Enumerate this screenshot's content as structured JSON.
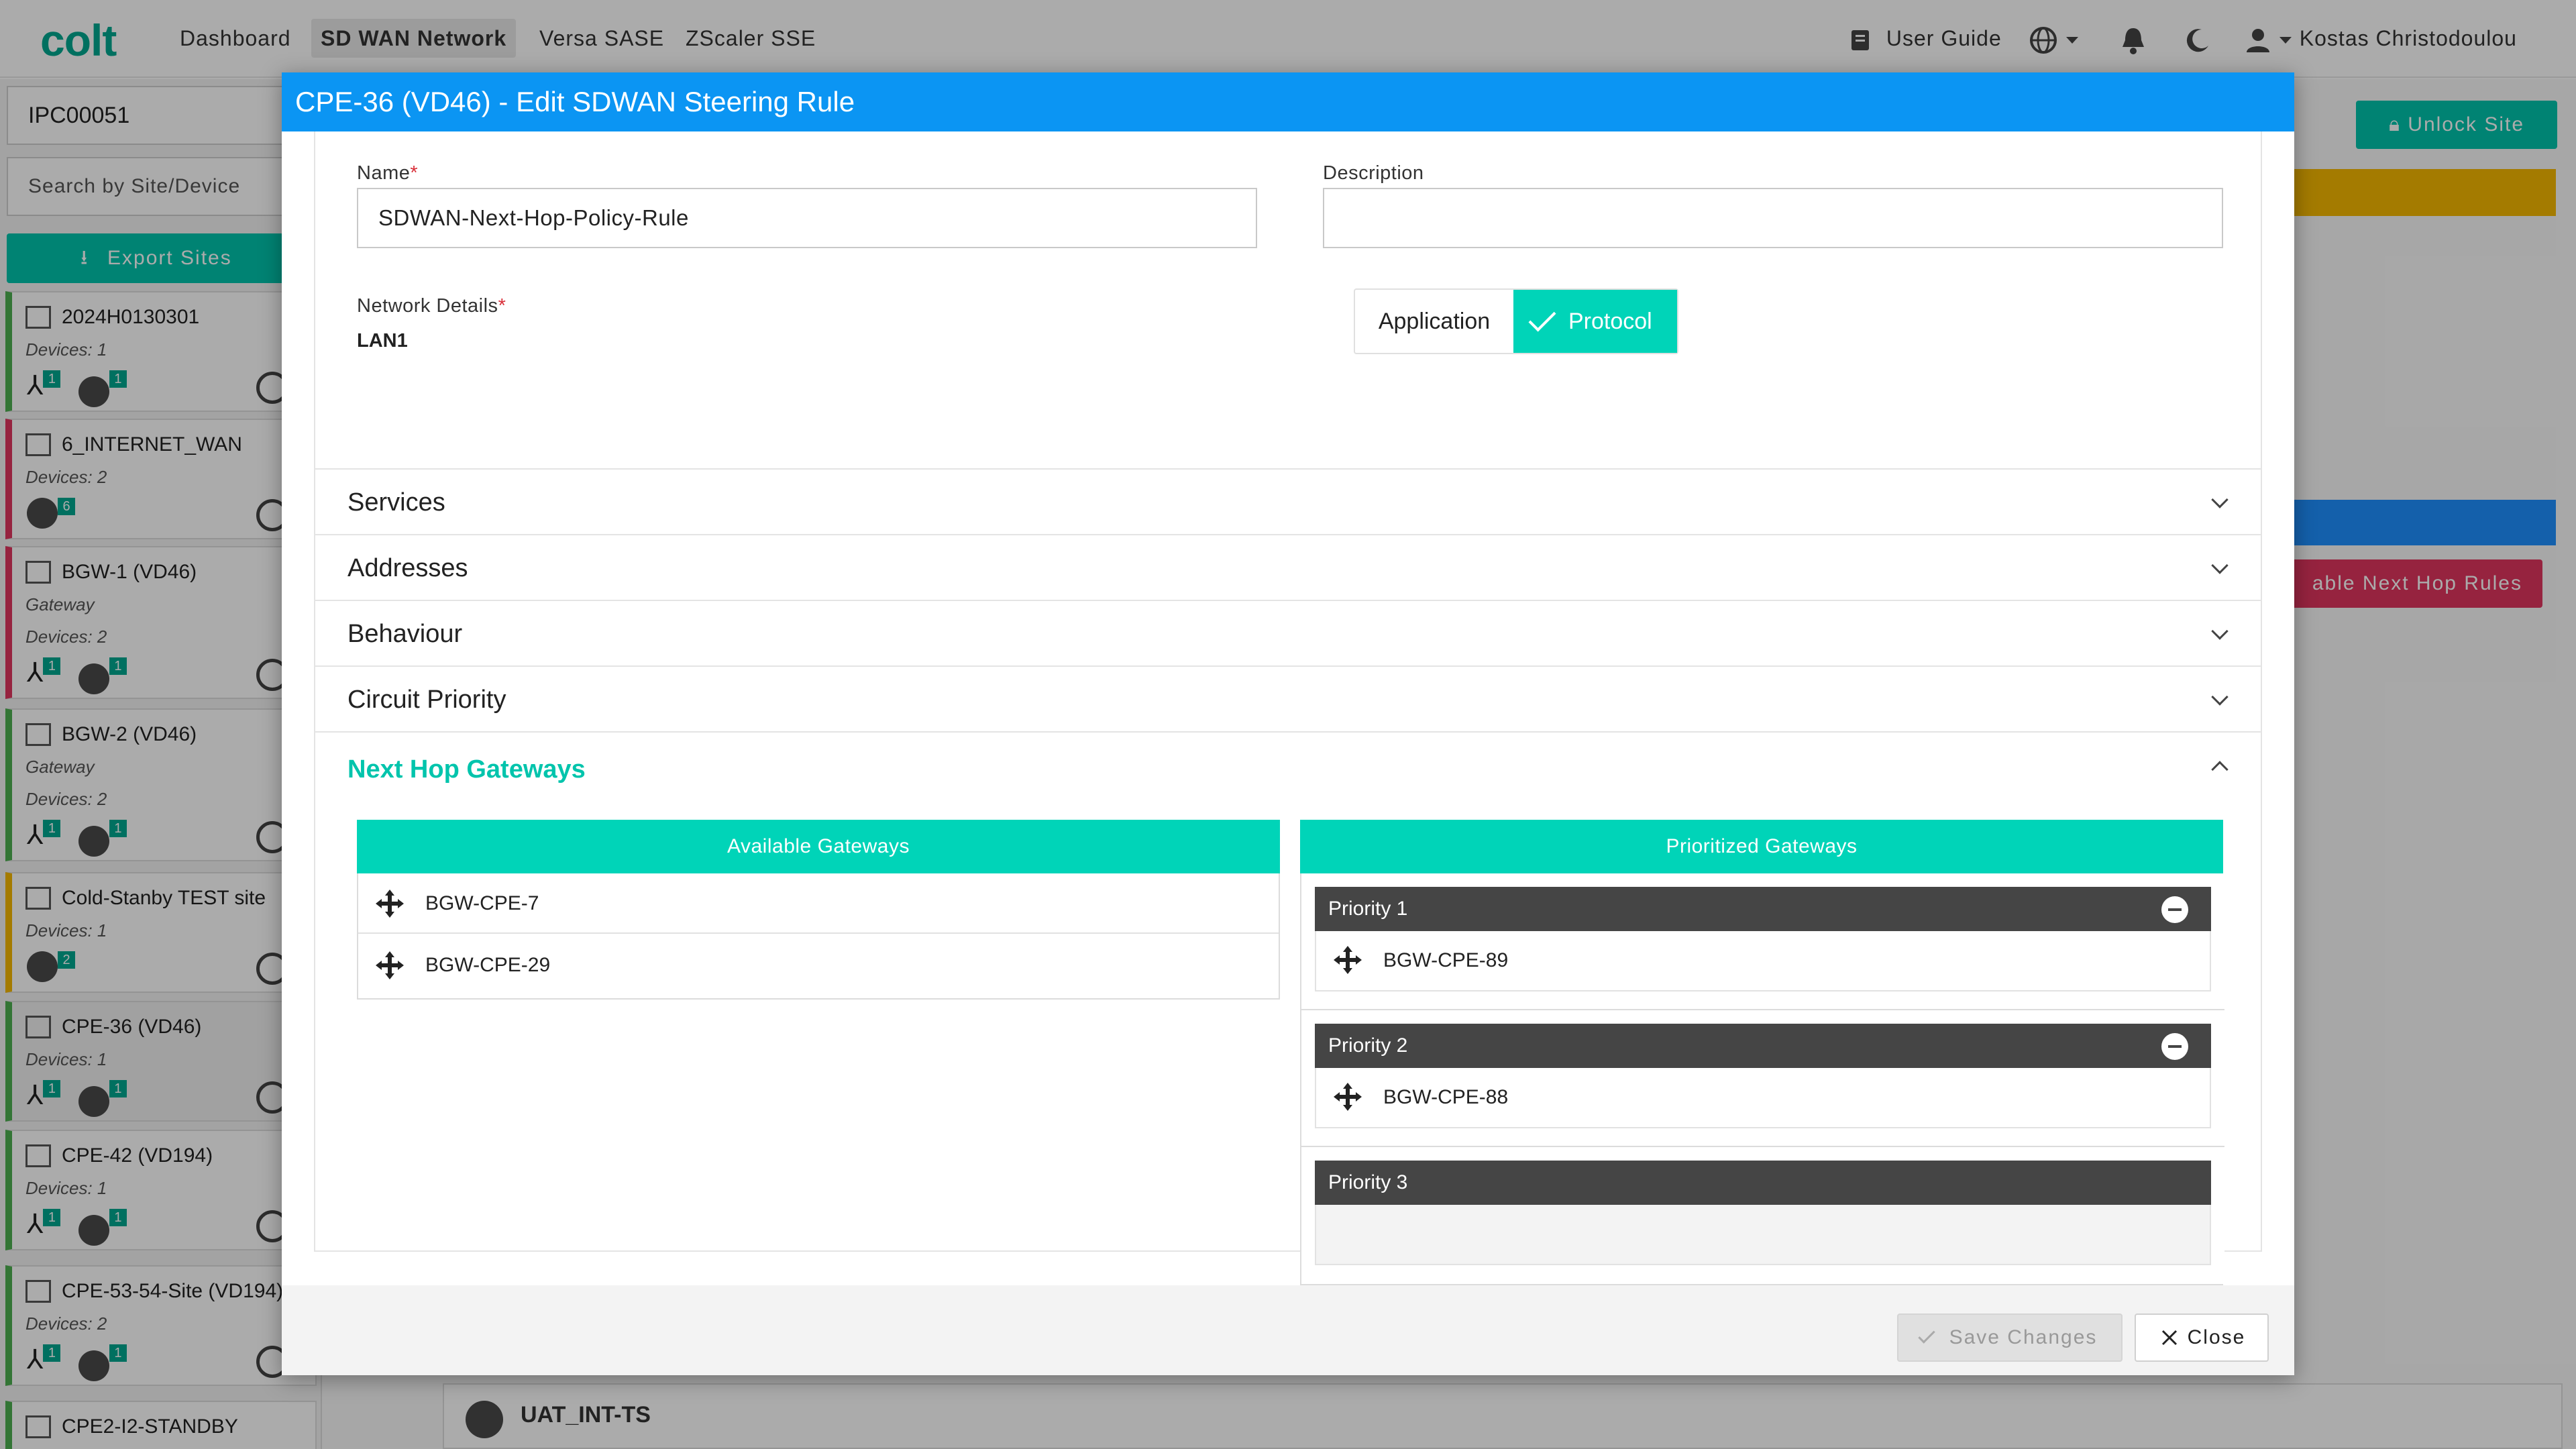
{
  "app": {
    "logo": "colt",
    "nav": [
      "Dashboard",
      "SD WAN Network",
      "Versa SASE",
      "ZScaler SSE"
    ],
    "user_guide": "User Guide",
    "user_name": "Kostas Christodoulou"
  },
  "sidebar": {
    "site_id": "IPC00051",
    "search_placeholder": "Search by Site/Device",
    "export_label": "Export Sites",
    "sites": [
      {
        "name": "2024H0130301",
        "type": "",
        "devices": "Devices: 1",
        "badges": [
          "1",
          "1"
        ],
        "color": "#4caf50"
      },
      {
        "name": "6_INTERNET_WAN",
        "type": "",
        "devices": "Devices: 2",
        "badges": [
          "6"
        ],
        "color": "#e0355e"
      },
      {
        "name": "BGW-1 (VD46)",
        "type": "Gateway",
        "devices": "Devices: 2",
        "badges": [
          "1",
          "1"
        ],
        "color": "#e0355e"
      },
      {
        "name": "BGW-2 (VD46)",
        "type": "Gateway",
        "devices": "Devices: 2",
        "badges": [
          "1",
          "1"
        ],
        "color": "#4caf50"
      },
      {
        "name": "Cold-Stanby TEST site",
        "type": "",
        "devices": "Devices: 1",
        "badges": [
          "2"
        ],
        "color": "#f5b800"
      },
      {
        "name": "CPE-36 (VD46)",
        "type": "",
        "devices": "Devices: 1",
        "badges": [
          "1",
          "1"
        ],
        "color": "#4caf50"
      },
      {
        "name": "CPE-42 (VD194)",
        "type": "",
        "devices": "Devices: 1",
        "badges": [
          "1",
          "1"
        ],
        "color": "#4caf50"
      },
      {
        "name": "CPE-53-54-Site (VD194)",
        "type": "",
        "devices": "Devices: 2",
        "badges": [
          "1",
          "1"
        ],
        "color": "#4caf50"
      },
      {
        "name": "CPE2-I2-STANDBY",
        "type": "",
        "devices": "",
        "badges": [],
        "color": "#4caf50"
      }
    ]
  },
  "background": {
    "unlock_label": "Unlock Site",
    "disable_rules_label": "able Next Hop Rules",
    "partial_button": "r",
    "uat_row_label": "UAT_INT-TS"
  },
  "modal": {
    "title": "CPE-36 (VD46) - Edit SDWAN Steering Rule",
    "name_label": "Name",
    "name_value": "SDWAN-Next-Hop-Policy-Rule",
    "description_label": "Description",
    "description_value": "",
    "network_label": "Network Details",
    "network_value": "LAN1",
    "toggle_application": "Application",
    "toggle_protocol": "Protocol",
    "sections": [
      "Services",
      "Addresses",
      "Behaviour",
      "Circuit Priority"
    ],
    "next_hop_title": "Next Hop Gateways",
    "available_title": "Available Gateways",
    "available": [
      "BGW-CPE-7",
      "BGW-CPE-29"
    ],
    "prioritized_title": "Prioritized Gateways",
    "priorities": [
      {
        "label": "Priority 1",
        "gateway": "BGW-CPE-89"
      },
      {
        "label": "Priority 2",
        "gateway": "BGW-CPE-88"
      },
      {
        "label": "Priority 3",
        "gateway": ""
      }
    ],
    "save_label": "Save Changes",
    "close_label": "Close"
  },
  "colors": {
    "accent": "#00d4b8",
    "header_blue": "#0b95f3",
    "priority_head": "#454545",
    "danger": "#e0355e"
  }
}
